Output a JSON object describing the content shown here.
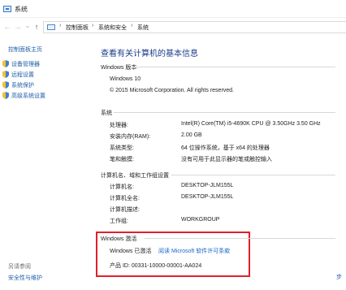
{
  "window": {
    "title": "系统"
  },
  "nav": {
    "back": "←",
    "forward": "→",
    "dropdown": "⌄",
    "up": "↑",
    "breadcrumb": [
      "控制面板",
      "系统和安全",
      "系统"
    ],
    "separator": "›"
  },
  "sidebar": {
    "home": "控制面板主页",
    "links": [
      "设备管理器",
      "远程设置",
      "系统保护",
      "高级系统设置"
    ],
    "see_also_heading": "另请参阅",
    "see_also_links": [
      "安全性与维护"
    ]
  },
  "main": {
    "title": "查看有关计算机的基本信息",
    "edition": {
      "heading": "Windows 版本",
      "name": "Windows 10",
      "copyright": "© 2015 Microsoft Corporation. All rights reserved."
    },
    "system": {
      "heading": "系统",
      "rows": [
        {
          "label": "处理器:",
          "value": "Intel(R) Core(TM) i5-4690K CPU @ 3.50GHz   3.50 GHz"
        },
        {
          "label": "安装内存(RAM):",
          "value": "2.00 GB"
        },
        {
          "label": "系统类型:",
          "value": "64 位操作系统，基于 x64 的处理器"
        },
        {
          "label": "笔和触摸:",
          "value": "没有可用于此显示器的笔或触控输入"
        }
      ]
    },
    "computer": {
      "heading": "计算机名、域和工作组设置",
      "rows": [
        {
          "label": "计算机名:",
          "value": "DESKTOP-JLM155L"
        },
        {
          "label": "计算机全名:",
          "value": "DESKTOP-JLM155L"
        },
        {
          "label": "计算机描述:",
          "value": ""
        },
        {
          "label": "工作组:",
          "value": "WORKGROUP"
        }
      ]
    },
    "activation": {
      "heading": "Windows 激活",
      "status": "Windows 已激活",
      "license_link": "阅读 Microsoft 软件许可条款",
      "product_id": "产品 ID: 00331-10000-00001-AA024"
    }
  },
  "edge_fragment": "步"
}
